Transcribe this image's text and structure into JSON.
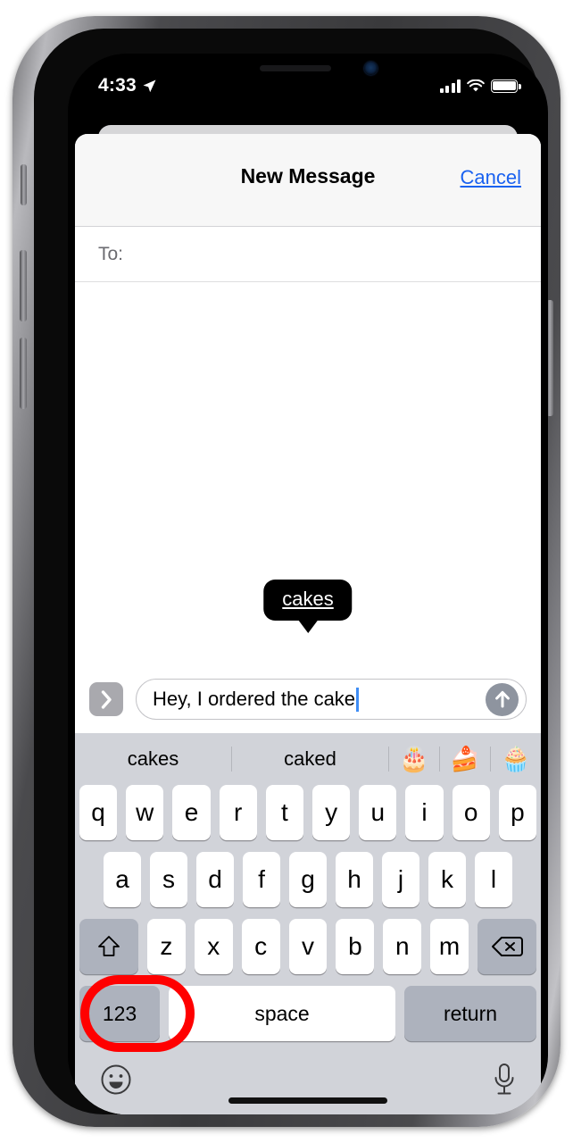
{
  "status_bar": {
    "time": "4:33",
    "location_icon": "location-arrow-icon",
    "signal_icon": "cellular-signal-icon",
    "wifi_icon": "wifi-icon",
    "battery_icon": "battery-full-icon"
  },
  "nav": {
    "title": "New Message",
    "cancel_label": "Cancel",
    "cancel_color": "#1a62f0"
  },
  "recipient": {
    "to_label": "To:"
  },
  "tooltip": {
    "text": "cakes",
    "background": "#000000"
  },
  "compose": {
    "expand_icon": "chevron-right-icon",
    "message_text": "Hey, I ordered the cake",
    "send_icon": "arrow-up-icon",
    "cursor_color": "#3e8df5"
  },
  "predictive": {
    "words": [
      "cakes",
      "caked"
    ],
    "emoji": [
      "🎂",
      "🍰",
      "🧁"
    ],
    "emoji_names": [
      "birthday-cake-emoji",
      "shortcake-emoji",
      "cupcake-emoji"
    ]
  },
  "keyboard": {
    "row1": [
      "q",
      "w",
      "e",
      "r",
      "t",
      "y",
      "u",
      "i",
      "o",
      "p"
    ],
    "row2": [
      "a",
      "s",
      "d",
      "f",
      "g",
      "h",
      "j",
      "k",
      "l"
    ],
    "row3": [
      "z",
      "x",
      "c",
      "v",
      "b",
      "n",
      "m"
    ],
    "shift_icon": "shift-arrow-icon",
    "delete_icon": "backspace-delete-icon",
    "numeric_label": "123",
    "space_label": "space",
    "return_label": "return",
    "emoji_button_icon": "smiley-face-icon",
    "dictation_icon": "microphone-icon"
  },
  "annotation": {
    "target": "123",
    "color": "#ff0000",
    "shape": "oval-highlight"
  }
}
